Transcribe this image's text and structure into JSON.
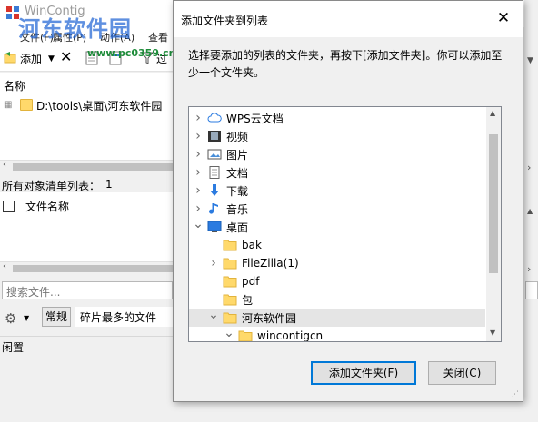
{
  "background_app": {
    "title": "WinContig",
    "menu": [
      "文件(F)",
      "属性(P)",
      "动作(A)",
      "查看"
    ],
    "toolbar": {
      "add_label": "添加",
      "last_label": "过"
    },
    "column_name": "名称",
    "list_item": "D:\\tools\\桌面\\河东软件园",
    "all_objects_label": "所有对象清单列表：",
    "all_objects_count": "1",
    "file_name_col": "文件名称",
    "search_placeholder": "搜索文件...",
    "tab_normal": "常规",
    "profile_value": "碎片最多的文件",
    "status": "闲置"
  },
  "watermark": {
    "text": "河东软件园",
    "url": "www.pc0359.cn"
  },
  "dialog": {
    "title": "添加文件夹到列表",
    "description": "选择要添加的列表的文件夹，再按下[添加文件夹]。你可以添加至少一个文件夹。",
    "tree": [
      {
        "label": "WPS云文档",
        "icon": "cloud-icon",
        "arrow": "›"
      },
      {
        "label": "视频",
        "icon": "video-icon",
        "arrow": "›"
      },
      {
        "label": "图片",
        "icon": "picture-icon",
        "arrow": "›"
      },
      {
        "label": "文档",
        "icon": "document-icon",
        "arrow": "›"
      },
      {
        "label": "下载",
        "icon": "download-icon",
        "arrow": "›"
      },
      {
        "label": "音乐",
        "icon": "music-icon",
        "arrow": "›"
      },
      {
        "label": "桌面",
        "icon": "desktop-icon",
        "arrow": "⌄"
      },
      {
        "label": "bak",
        "icon": "folder-icon",
        "arrow": ""
      },
      {
        "label": "FileZilla(1)",
        "icon": "folder-icon",
        "arrow": "›"
      },
      {
        "label": "pdf",
        "icon": "folder-icon",
        "arrow": ""
      },
      {
        "label": "包",
        "icon": "folder-icon",
        "arrow": ""
      },
      {
        "label": "河东软件园",
        "icon": "folder-icon",
        "arrow": "⌄",
        "selected": true
      },
      {
        "label": "wincontigcn",
        "icon": "folder-icon",
        "arrow": "⌄"
      }
    ],
    "add_button": "添加文件夹(F)",
    "close_button": "关闭(C)"
  },
  "colors": {
    "accent": "#0078d7",
    "folder": "#ffd96b",
    "watermark": "#2a6bd6"
  }
}
